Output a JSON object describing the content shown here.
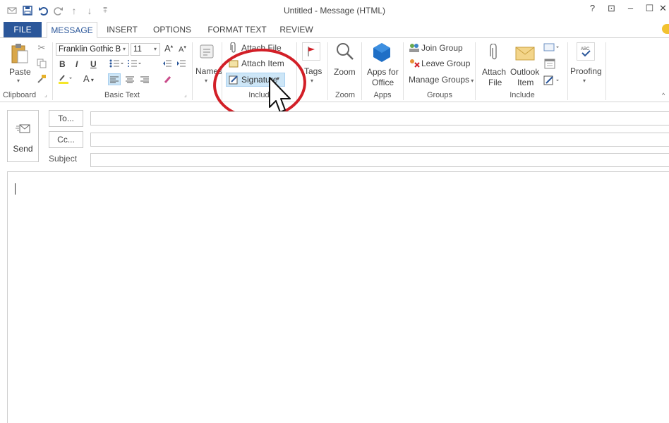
{
  "window": {
    "title": "Untitled - Message (HTML)",
    "help": "?",
    "restore_ribbon": "⊡",
    "minimize": "–",
    "maximize": "☐",
    "close": "✕"
  },
  "qat": [
    "envelope-icon",
    "save-icon",
    "undo-icon",
    "redo-icon",
    "up-icon",
    "down-icon",
    "customize-icon"
  ],
  "tabs": {
    "file": "FILE",
    "items": [
      "MESSAGE",
      "INSERT",
      "OPTIONS",
      "FORMAT TEXT",
      "REVIEW"
    ],
    "active": "MESSAGE"
  },
  "ribbon": {
    "clipboard": {
      "label": "Clipboard",
      "paste": "Paste"
    },
    "basic_text": {
      "label": "Basic Text",
      "font": "Franklin Gothic B",
      "size": "11",
      "bold": "B",
      "italic": "I",
      "underline": "U",
      "grow": "A",
      "shrink": "A"
    },
    "names": {
      "label": "Names"
    },
    "include": {
      "label": "Include",
      "attach_file": "Attach File",
      "attach_item": "Attach Item",
      "signature": "Signature"
    },
    "tags": {
      "label": "Tags"
    },
    "zoom": {
      "label": "Zoom",
      "group_label": "Zoom"
    },
    "apps": {
      "label_1": "Apps for",
      "label_2": "Office",
      "group_label": "Apps"
    },
    "groups": {
      "join": "Join Group",
      "leave": "Leave Group",
      "manage": "Manage Groups",
      "group_label": "Groups"
    },
    "include2": {
      "attach_1": "Attach",
      "attach_2": "File",
      "outlook_1": "Outlook",
      "outlook_2": "Item",
      "group_label": "Include"
    },
    "proofing": {
      "label": "Proofing"
    }
  },
  "compose": {
    "send": "Send",
    "to": "To...",
    "cc": "Cc...",
    "subject": "Subject",
    "to_value": "",
    "cc_value": "",
    "subject_value": "",
    "body": ""
  },
  "colors": {
    "accent": "#2b579a",
    "annotation": "#d21f27",
    "highlight": "#cde6f7"
  }
}
